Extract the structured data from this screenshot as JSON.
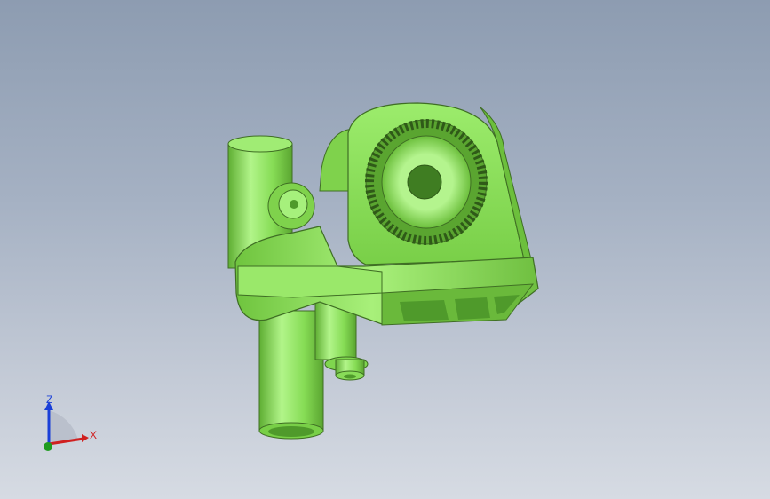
{
  "viewport": {
    "background_top": "#8d9cb1",
    "background_bottom": "#d6dbe3"
  },
  "model": {
    "body_color": "#8ee35a",
    "edge_color": "#3f6e24"
  },
  "triad": {
    "z_label": "Z",
    "x_label": "X",
    "z_color": "#1a3fd8",
    "x_color": "#d02020",
    "y_color": "#1f9b1f"
  }
}
